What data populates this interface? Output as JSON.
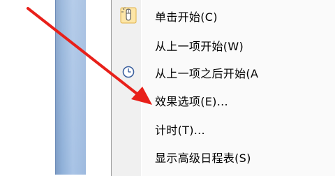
{
  "menu": {
    "items": [
      {
        "label": "单击开始(C)",
        "icon": "mouse-click-icon"
      },
      {
        "label": "从上一项开始(W)",
        "icon": null
      },
      {
        "label": "从上一项之后开始(A",
        "icon": "clock-icon"
      },
      {
        "label": "效果选项(E)...",
        "icon": null
      },
      {
        "label": "计时(T)...",
        "icon": null
      },
      {
        "label": "显示高级日程表(S)",
        "icon": null
      }
    ]
  },
  "annotation": {
    "arrow_color": "#e8201a",
    "arrow_target": "效果选项(E)..."
  },
  "colors": {
    "sidebar_blue": "#9db9de",
    "menu_bg": "#fafafa",
    "gutter_bg": "#f0f0f0"
  }
}
